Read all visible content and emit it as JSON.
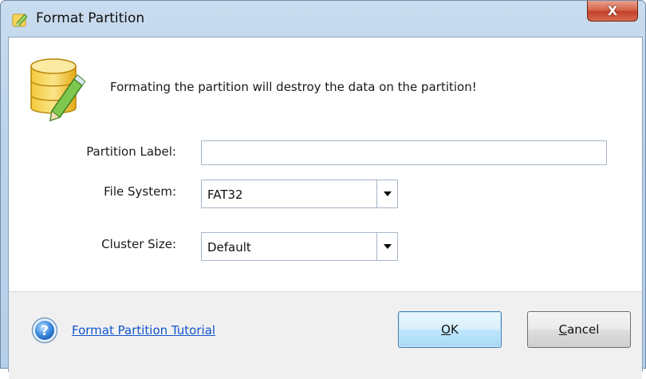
{
  "window": {
    "title": "Format Partition",
    "close_glyph": "X"
  },
  "message": {
    "warning": "Formating the partition will destroy the data on the partition!"
  },
  "form": {
    "partition_label": {
      "label": "Partition Label:",
      "value": ""
    },
    "file_system": {
      "label": "File System:",
      "value": "FAT32"
    },
    "cluster_size": {
      "label": "Cluster Size:",
      "value": "Default"
    }
  },
  "footer": {
    "help_link": "Format Partition Tutorial",
    "ok": {
      "mnemonic": "O",
      "rest": "K"
    },
    "cancel": {
      "mnemonic": "C",
      "rest": "ancel"
    }
  },
  "icons": {
    "title": "pencil-icon",
    "header": "database-pencil-icon",
    "help": "help-icon",
    "dropdown": "chevron-down-icon"
  }
}
